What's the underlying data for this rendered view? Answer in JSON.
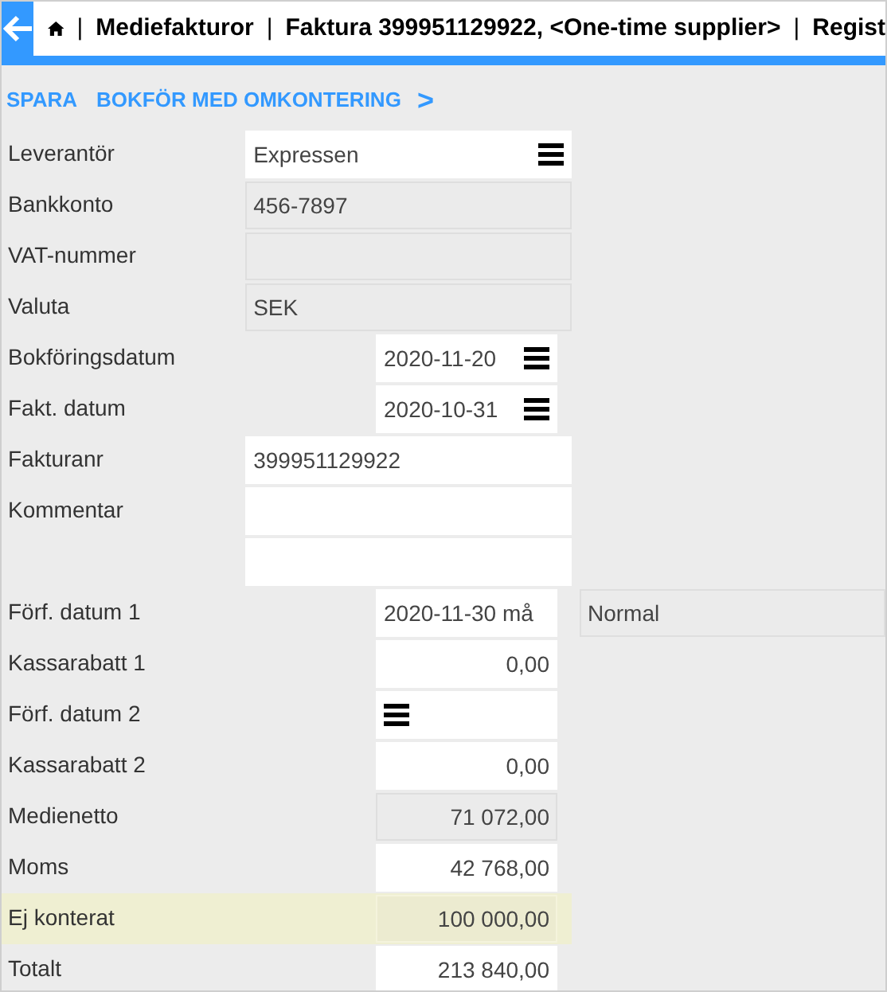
{
  "header": {
    "breadcrumbs": [
      "Mediefakturor",
      "Faktura 399951129922, <One-time supplier>",
      "Regist"
    ],
    "separator": "|"
  },
  "toolbar": {
    "actions": [
      "SPARA",
      "BOKFÖR MED OMKONTERING"
    ],
    "next": ">"
  },
  "fields": [
    {
      "label": "Leverantör",
      "value": "Expressen",
      "readonly": false,
      "menu": true,
      "kind": "wide",
      "highlighted": false
    },
    {
      "label": "Bankkonto",
      "value": "456-7897",
      "readonly": true,
      "menu": false,
      "kind": "wide",
      "highlighted": false
    },
    {
      "label": "VAT-nummer",
      "readonly": true,
      "menu": false,
      "kind": "wide",
      "highlighted": false
    },
    {
      "label": "Valuta",
      "value": "SEK",
      "readonly": true,
      "menu": false,
      "kind": "wide",
      "highlighted": false
    },
    {
      "label": "Bokföringsdatum",
      "value": "2020-11-20",
      "readonly": false,
      "menu": true,
      "kind": "short",
      "highlighted": false
    },
    {
      "label": "Fakt. datum",
      "value": "2020-10-31",
      "readonly": false,
      "menu": true,
      "kind": "short",
      "highlighted": false
    },
    {
      "label": "Fakturanr",
      "value": "399951129922",
      "readonly": false,
      "menu": false,
      "kind": "wide",
      "highlighted": false
    },
    {
      "label": "Kommentar",
      "readonly": false,
      "menu": false,
      "kind": "wide",
      "highlighted": false
    },
    {
      "readonly": false,
      "menu": false,
      "kind": "wide",
      "highlighted": false
    },
    {
      "label": "Förf. datum 1",
      "value": "2020-11-30 må",
      "readonly": false,
      "menu": false,
      "kind": "short",
      "highlighted": false,
      "extra": {
        "value": "Normal",
        "readonly": true
      }
    },
    {
      "label": "Kassarabatt 1",
      "value": "0,00",
      "readonly": false,
      "menu": false,
      "kind": "amount",
      "highlighted": false
    },
    {
      "label": "Förf. datum 2",
      "readonly": false,
      "menu": true,
      "kind": "short",
      "highlighted": false
    },
    {
      "label": "Kassarabatt 2",
      "value": "0,00",
      "readonly": false,
      "menu": false,
      "kind": "amount",
      "highlighted": false
    },
    {
      "label": "Medienetto",
      "value": "71 072,00",
      "readonly": true,
      "menu": false,
      "kind": "amount",
      "highlighted": false
    },
    {
      "label": "Moms",
      "value": "42 768,00",
      "readonly": false,
      "menu": false,
      "kind": "amount",
      "highlighted": false
    },
    {
      "label": "Ej konterat",
      "value": "100 000,00",
      "readonly": true,
      "menu": false,
      "kind": "amount",
      "highlighted": true
    },
    {
      "label": "Totalt",
      "value": "213 840,00",
      "readonly": false,
      "menu": false,
      "kind": "amount",
      "highlighted": false
    }
  ]
}
